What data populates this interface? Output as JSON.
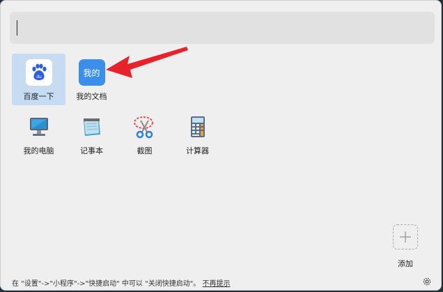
{
  "search": {
    "value": ""
  },
  "apps": [
    {
      "label": "百度一下",
      "icon": "baidu-paw-icon"
    },
    {
      "label": "我的文档",
      "icon": "my-documents-icon",
      "icon_text": "我的"
    },
    {
      "label": "我的电脑",
      "icon": "computer-monitor-icon"
    },
    {
      "label": "记事本",
      "icon": "notepad-icon"
    },
    {
      "label": "截图",
      "icon": "scissors-screenshot-icon"
    },
    {
      "label": "计算器",
      "icon": "calculator-icon"
    }
  ],
  "add": {
    "label": "添加",
    "icon": "plus-icon"
  },
  "footer": {
    "hint": "在 \"设置\"->\"小程序\"->\"快捷启动\" 中可以 \"关闭快捷启动\"。",
    "link": "不再提示"
  },
  "settings_icon": "gear-icon",
  "colors": {
    "accent": "#3b8eea",
    "selected": "#c5dcf2",
    "arrow": "#e8222a"
  }
}
